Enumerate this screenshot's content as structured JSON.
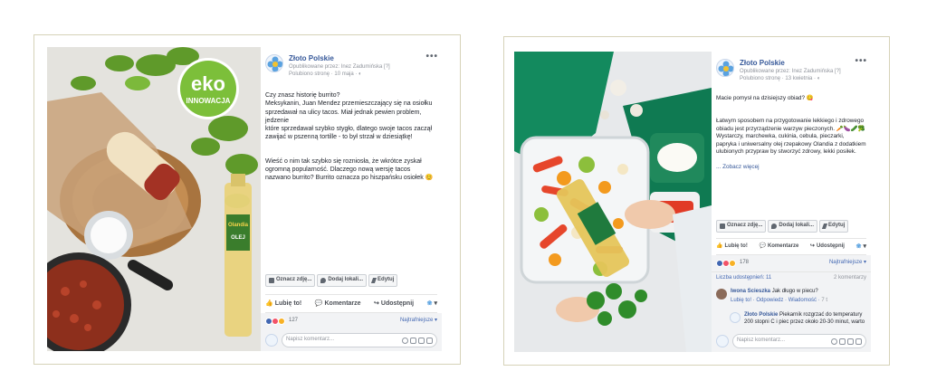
{
  "posts": [
    {
      "page_name": "Złoto Polskie",
      "published_by": "Opublikowane przez: Inez Zadumińska [?]",
      "liked_by": "Polubiono stronę · 10 maja · ",
      "menu": "•••",
      "body": [
        "Czy znasz historię burrito?\nMeksykanin, Juan Mendez przemieszczający się na osiołku sprzedawał na ulicy tacos. Miał jednak pewien problem, jedzenie\nktóre sprzedawał szybko stygło, dlatego swoje tacos zaczął zawijać w pszenną tortille - to był strzał w dziesiątkę!",
        "Wieść o nim tak szybko się rozniosła, że wkrótce zyskał ogromną popularność. Dlaczego nową wersję tacos nazwano burrito? Burrito oznacza po hiszpańsku osiołek 😊"
      ],
      "tag_buttons": [
        "Oznacz zdję...",
        "Dodaj lokali...",
        "Edytuj"
      ],
      "actions": [
        "Lubię to!",
        "Komentarze",
        "Udostępnij"
      ],
      "reaction_count": "127",
      "sort": "Najtrafniejsze ▾",
      "compose_placeholder": "Napisz komentarz...",
      "photo_badge": {
        "line1": "eko",
        "line2": "INNOWACJA"
      },
      "bottle_label": {
        "brand": "Olandia",
        "kind": "OLEJ"
      }
    },
    {
      "page_name": "Złoto Polskie",
      "published_by": "Opublikowane przez: Inez Zadumińska [?]",
      "liked_by": "Polubiono stronę · 13 kwietnia · ",
      "menu": "•••",
      "body": [
        "Macie pomysł na dzisiejszy obiad? 😋",
        "Łatwym sposobem na przygotowanie lekkiego i zdrowego obiadu jest przyrządzenie warzyw pieczonych. 🥕🍆🥒🥦\nWystarczy, marchewka, cukinia, cebula, pieczarki, papryka i uniwersalny olej rzepakowy Olandia z dodatkiem ulubionych przypraw by stworzyć zdrowy, lekki posiłek."
      ],
      "see_more": "... Zobacz więcej",
      "tag_buttons": [
        "Oznacz zdję...",
        "Dodaj lokali...",
        "Edytuj"
      ],
      "actions": [
        "Lubię to!",
        "Komentarze",
        "Udostępnij"
      ],
      "reaction_count": "178",
      "sort": "Najtrafniejsze ▾",
      "shares_label": "Liczba udostępnień: 11",
      "comments_count": "2 komentarzy",
      "comments": [
        {
          "author": "Iwona Scieszka",
          "text": "Jak długo w piecu?",
          "meta": "Lubię to! · Odpowiedz · Wiadomość · ",
          "time": "7 t"
        },
        {
          "author": "Złoto Polskie",
          "text": "Piekarnik rozgrzać do temperatury 200 stopni C i piec przez około 20-30 minut, warto",
          "meta": "",
          "time": ""
        }
      ],
      "compose_placeholder": "Napisz komentarz..."
    }
  ],
  "colors": {
    "fb_link": "#365899",
    "frame_border": "#d6d2b8",
    "reaction_like": "#4267b2",
    "reaction_love": "#f25268",
    "reaction_haha": "#f7b125"
  }
}
